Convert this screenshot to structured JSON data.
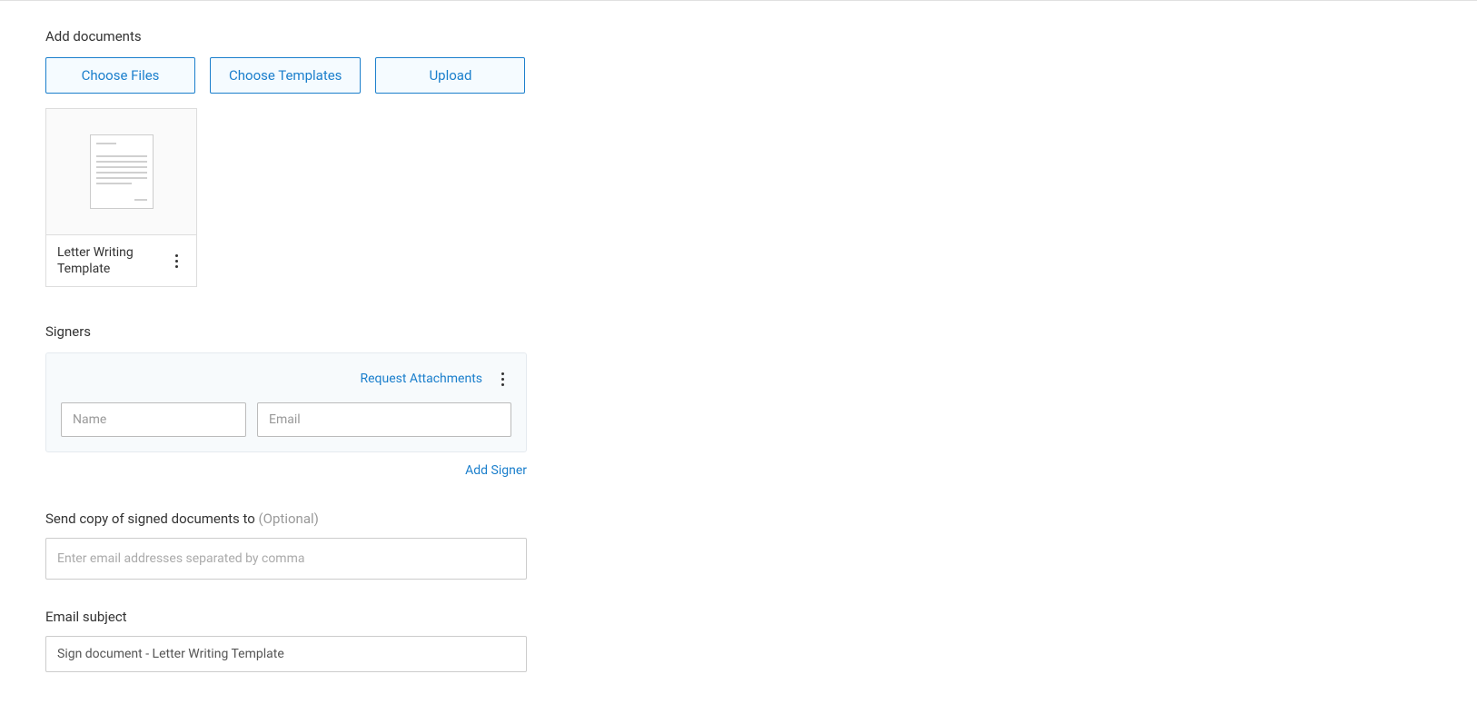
{
  "add_documents": {
    "title": "Add documents",
    "buttons": {
      "choose_files": "Choose Files",
      "choose_templates": "Choose Templates",
      "upload": "Upload"
    },
    "document": {
      "name": "Letter Writing Template"
    }
  },
  "signers": {
    "title": "Signers",
    "request_attachments": "Request Attachments",
    "name_placeholder": "Name",
    "email_placeholder": "Email",
    "add_signer": "Add Signer"
  },
  "send_copy": {
    "label": "Send copy of signed documents to ",
    "optional": "(Optional)",
    "placeholder": "Enter email addresses separated by comma"
  },
  "email_subject": {
    "label": "Email subject",
    "value": "Sign document - Letter Writing Template"
  }
}
